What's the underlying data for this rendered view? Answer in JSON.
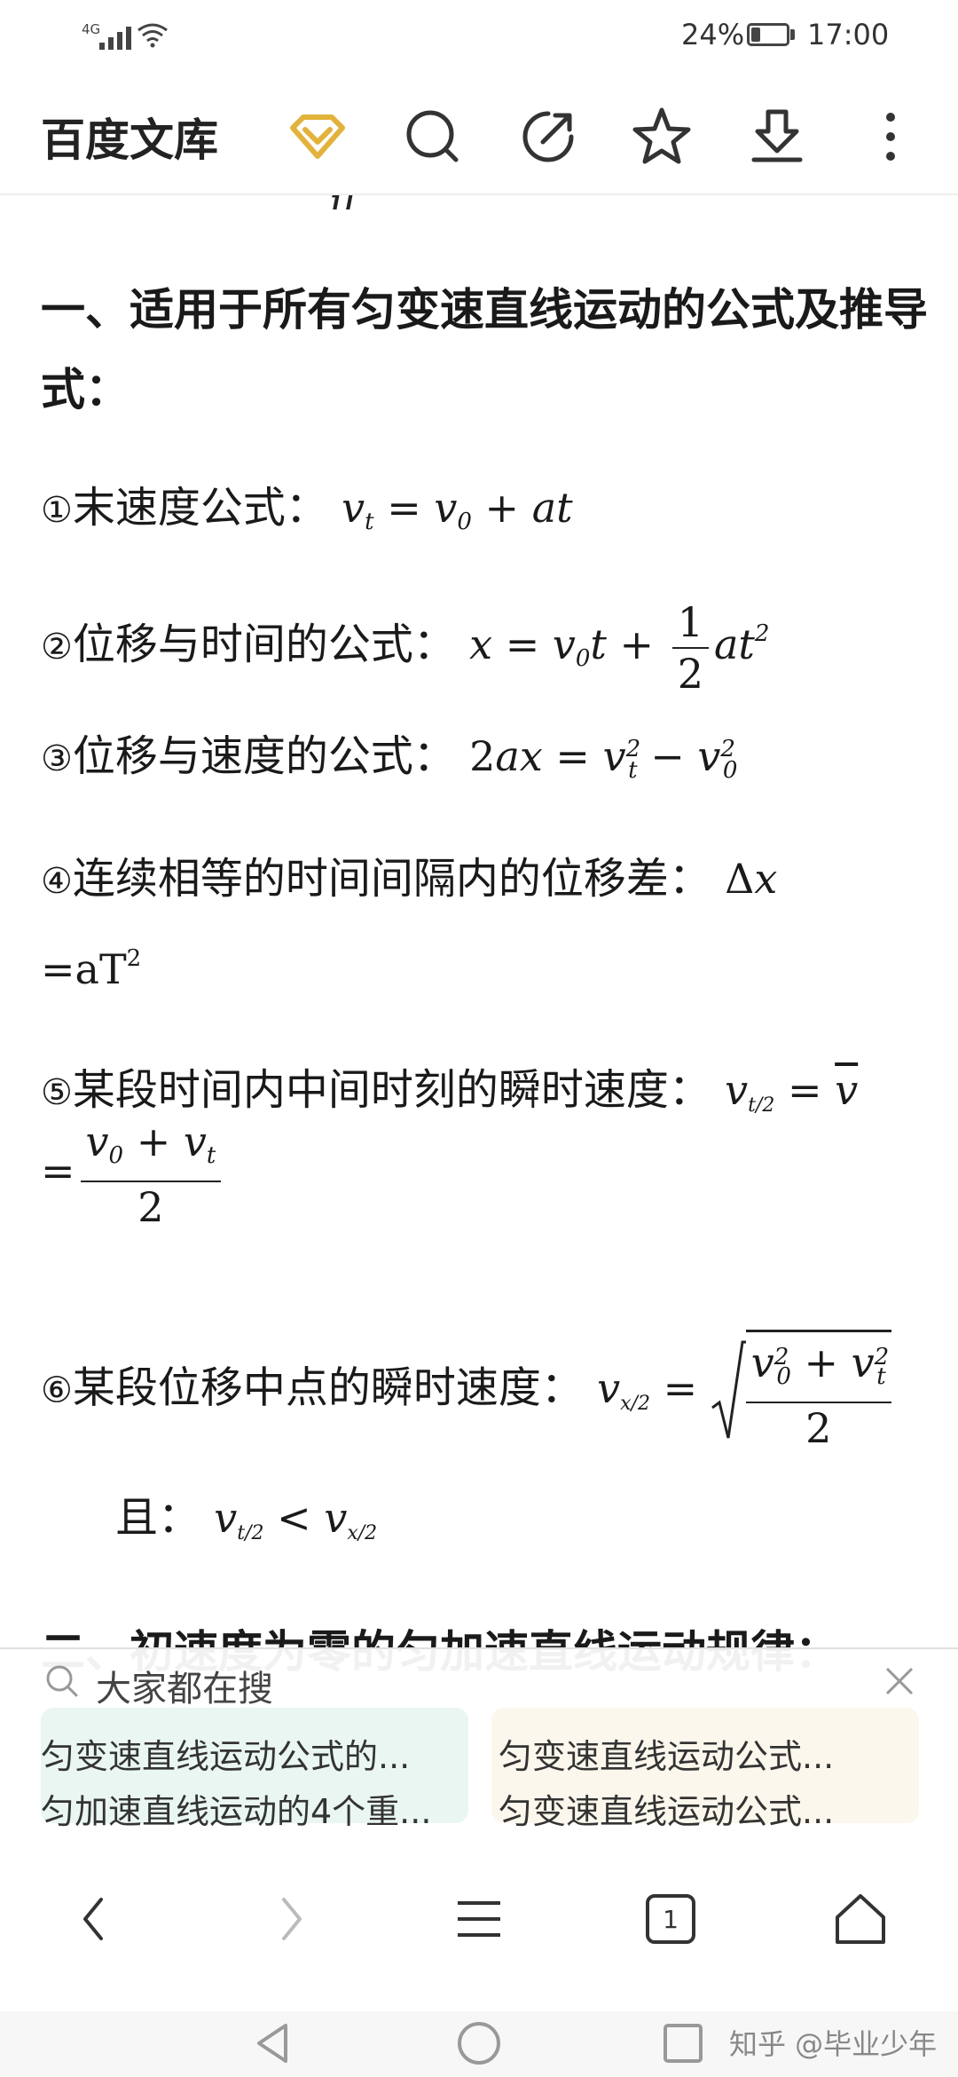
{
  "status_bar": {
    "network": "4G",
    "battery": "24%",
    "time": "17:00"
  },
  "toolbar": {
    "brand": "百度文库"
  },
  "article": {
    "cut_fragment": "u",
    "section1_title": "一、适用于所有匀变速直线运动的公式及推导式：",
    "f1": {
      "num": "①",
      "label": "末速度公式："
    },
    "f2": {
      "num": "②",
      "label": "位移与时间的公式："
    },
    "f3": {
      "num": "③",
      "label": "位移与速度的公式："
    },
    "f4": {
      "num": "④",
      "label": "连续相等的时间间隔内的位移差：",
      "cont": "=aT"
    },
    "f5": {
      "num": "⑤",
      "label": "某段时间内中间时刻的瞬时速度："
    },
    "f6": {
      "num": "⑥",
      "label": "某段位移中点的瞬时速度：",
      "and": "且："
    },
    "section2_title": "二、初速度为零的匀加速直线运动规律："
  },
  "suggest": {
    "title": "大家都在搜",
    "items": [
      "匀变速直线运动公式的...",
      "匀变速直线运动公式...",
      "匀加速直线运动的4个重...",
      "匀变速直线运动公式..."
    ]
  },
  "browser_nav": {
    "tab_count": "1"
  },
  "watermark": "知乎 @毕业少年"
}
